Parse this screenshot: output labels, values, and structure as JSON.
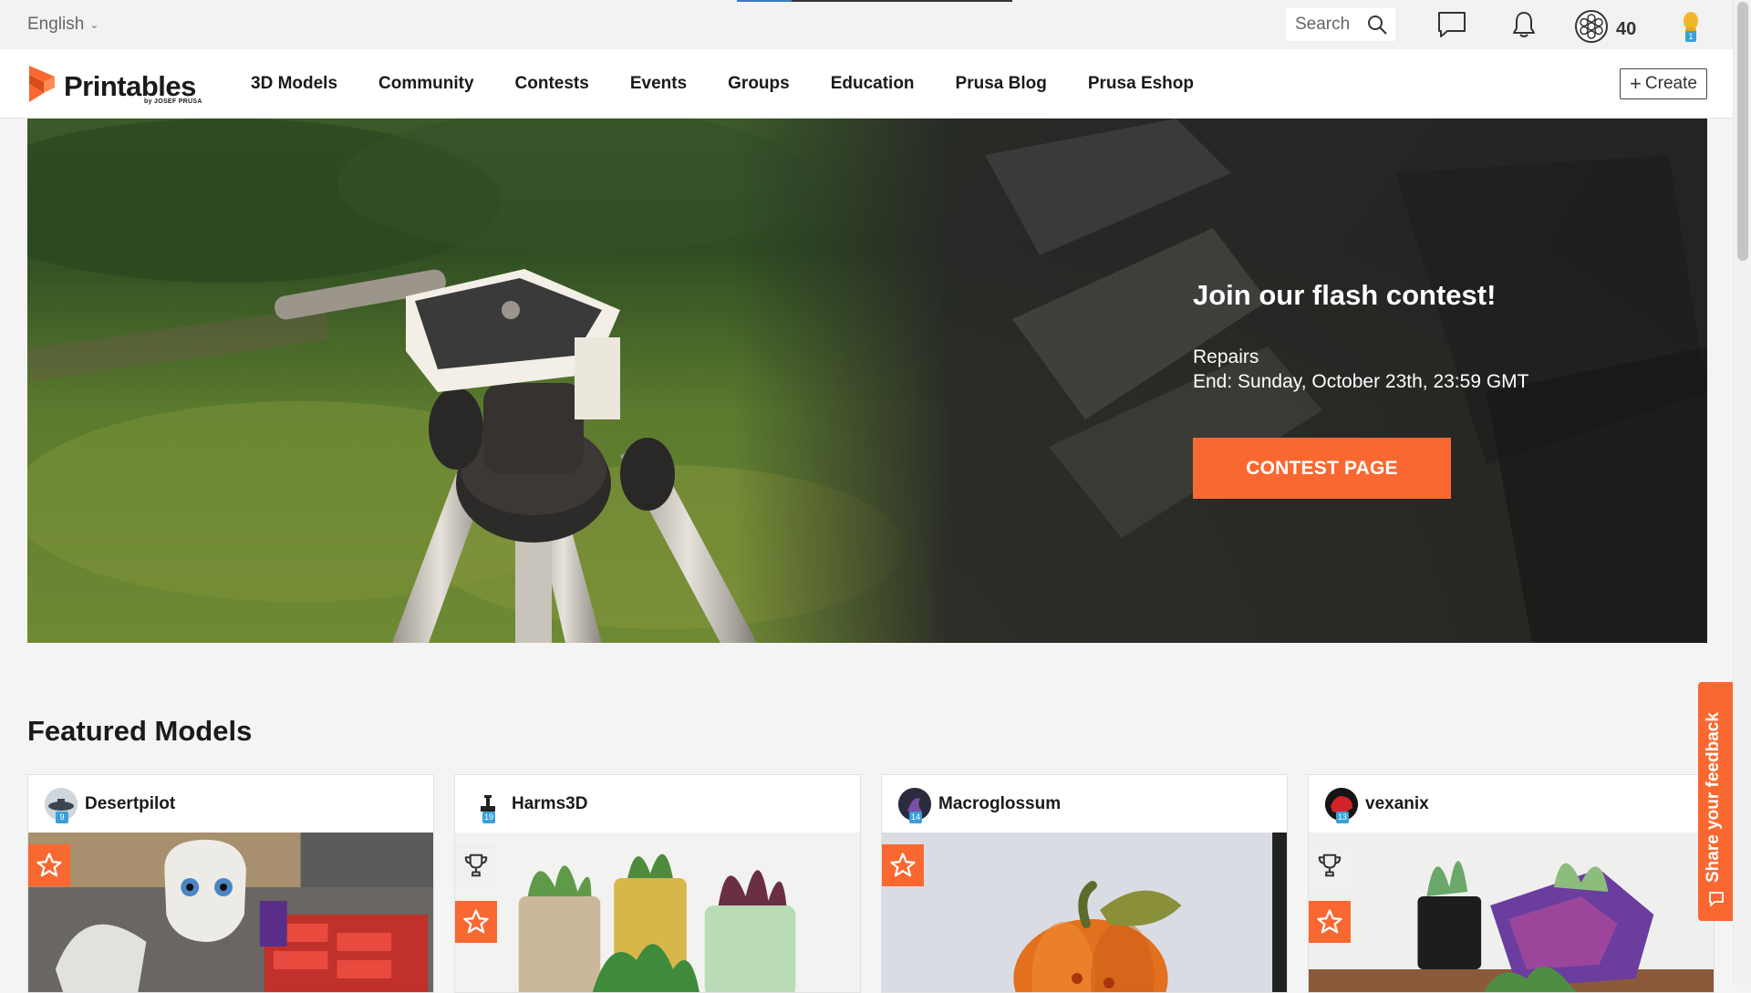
{
  "topbar": {
    "language": "English",
    "search_placeholder": "Search",
    "coins": "40",
    "avatar_level": "1"
  },
  "nav": {
    "logo_text": "Printables",
    "logo_subtext": "by JOSEF PRUSA",
    "items": [
      {
        "label": "3D Models"
      },
      {
        "label": "Community"
      },
      {
        "label": "Contests"
      },
      {
        "label": "Events"
      },
      {
        "label": "Groups"
      },
      {
        "label": "Education"
      },
      {
        "label": "Prusa Blog"
      },
      {
        "label": "Prusa Eshop"
      }
    ],
    "create_label": "Create"
  },
  "hero": {
    "title": "Join our flash contest!",
    "contest_name": "Repairs",
    "end_text": "End: Sunday, October 23th, 23:59 GMT",
    "button_label": "CONTEST PAGE"
  },
  "featured": {
    "title": "Featured Models",
    "cards": [
      {
        "user": "Desertpilot",
        "level": "9"
      },
      {
        "user": "Harms3D",
        "level": "19"
      },
      {
        "user": "Macroglossum",
        "level": "14"
      },
      {
        "user": "vexanix",
        "level": "13"
      }
    ]
  },
  "feedback_label": "Share your feedback",
  "colors": {
    "accent": "#fa6831",
    "level_badge": "#3aa0d8"
  }
}
